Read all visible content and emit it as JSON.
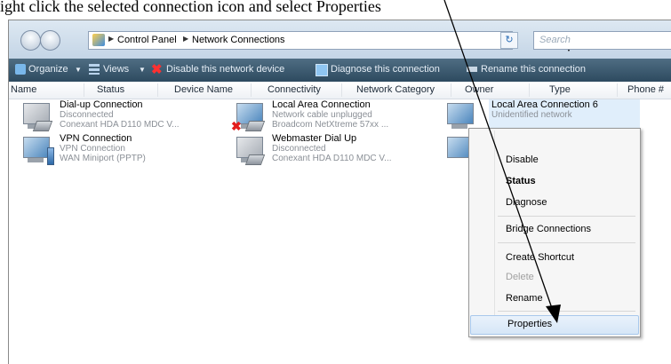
{
  "caption": "ight click the selected connection icon and select Properties",
  "address": {
    "crumbs": [
      "Control Panel",
      "Network Connections"
    ],
    "search_placeholder": "Search"
  },
  "toolbar": {
    "organize": "Organize",
    "views": "Views",
    "disable": "Disable this network device",
    "diagnose": "Diagnose this connection",
    "rename": "Rename this connection"
  },
  "columns": [
    "Name",
    "Status",
    "Device Name",
    "Connectivity",
    "Network Category",
    "Owner",
    "Type",
    "Phone #"
  ],
  "items": [
    {
      "name": "Dial-up Connection",
      "status": "Disconnected",
      "device": "Conexant HDA D110 MDC V..."
    },
    {
      "name": "Local Area Connection",
      "status": "Network cable unplugged",
      "device": "Broadcom NetXtreme 57xx ..."
    },
    {
      "name": "Local Area Connection 6",
      "status": "Unidentified network",
      "device": ""
    },
    {
      "name": "VPN Connection",
      "status": "VPN Connection",
      "device": "WAN Miniport (PPTP)"
    },
    {
      "name": "Webmaster Dial Up",
      "status": "Disconnected",
      "device": "Conexant HDA D110 MDC V..."
    }
  ],
  "context_menu": {
    "disable": "Disable",
    "status": "Status",
    "diagnose": "Diagnose",
    "bridge": "Bridge Connections",
    "shortcut": "Create Shortcut",
    "delete": "Delete",
    "rename": "Rename",
    "properties": "Properties"
  },
  "colors": {
    "toolbar": "#2d4a5f",
    "menu_hover": "#d6e6f7",
    "selection": "#e0eefb"
  }
}
